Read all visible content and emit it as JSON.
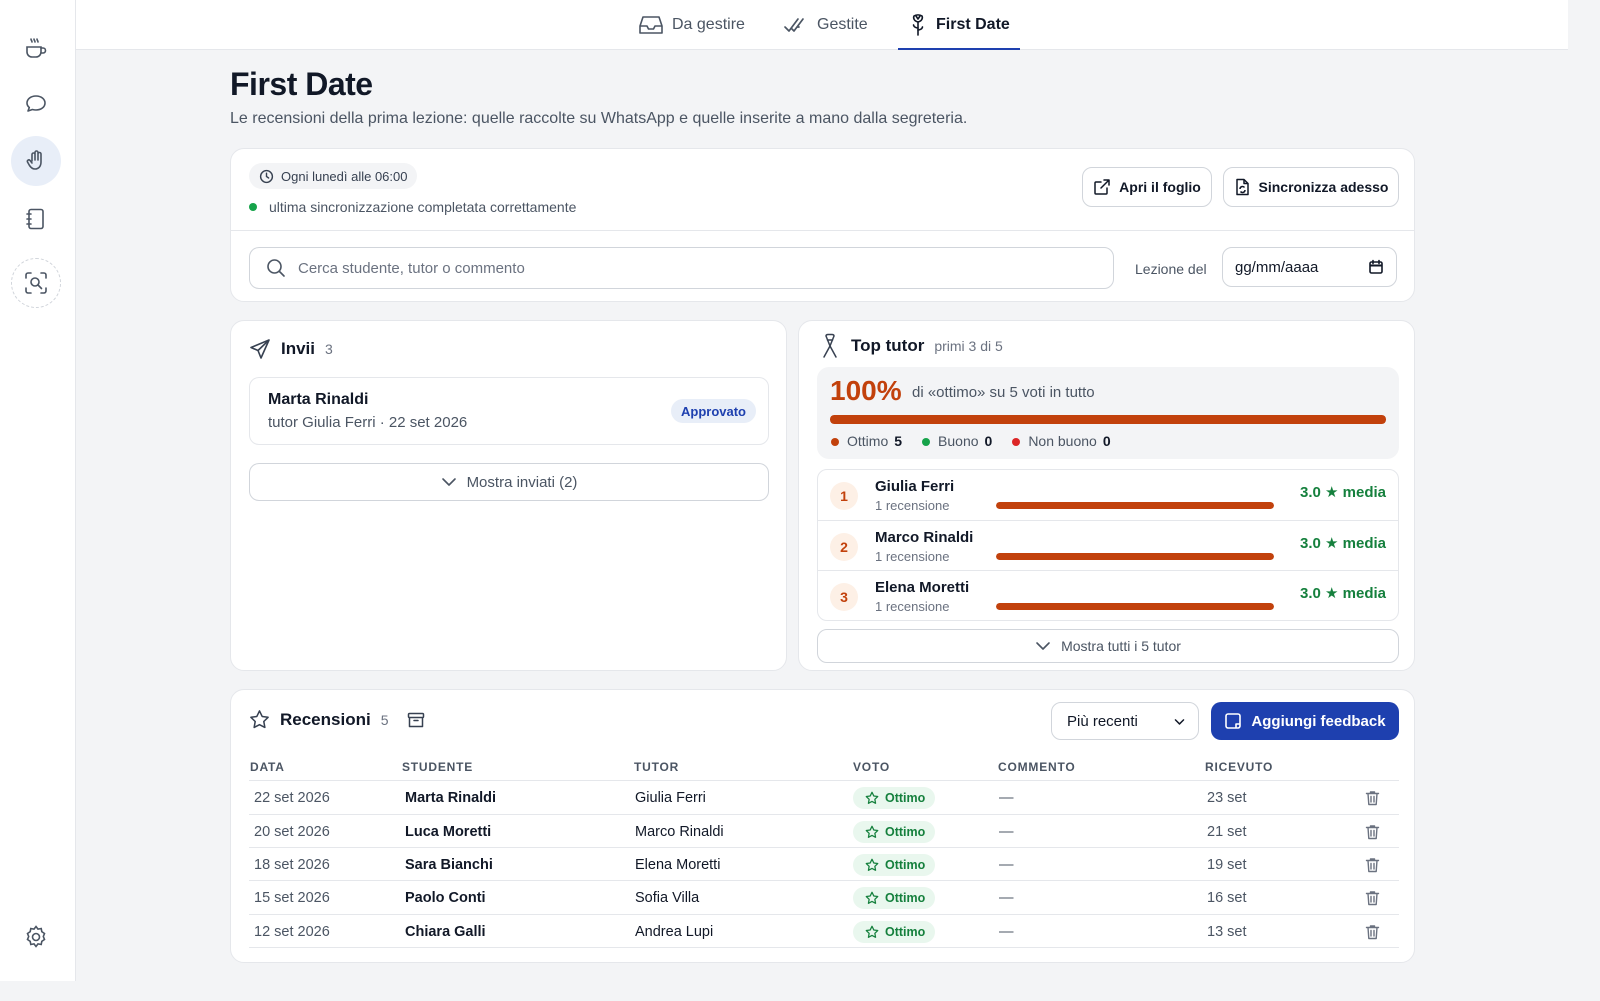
{
  "rail": {
    "items": [
      {
        "name": "coffee-icon"
      },
      {
        "name": "chat-bubble-icon"
      },
      {
        "name": "hand-icon"
      },
      {
        "name": "notebook-icon"
      },
      {
        "name": "scan-search-icon"
      }
    ],
    "settings_icon": "gear-icon"
  },
  "tabs": [
    {
      "label": "Da gestire",
      "icon": "inbox-icon"
    },
    {
      "label": "Gestite",
      "icon": "double-check-icon"
    },
    {
      "label": "First Date",
      "icon": "rose-icon",
      "active": true
    }
  ],
  "page": {
    "title": "First Date",
    "subtitle": "Le recensioni della prima lezione: quelle raccolte su WhatsApp e quelle inserite a mano dalla segreteria."
  },
  "sync": {
    "schedule": "Ogni lunedì alle 06:00",
    "status": "ultima sincronizzazione completata correttamente",
    "status_color": "#16a34a",
    "open_sheet": "Apri il foglio",
    "sync_now": "Sincronizza adesso"
  },
  "filters": {
    "search_placeholder": "Cerca studente, tutor o commento",
    "date_label": "Lezione del",
    "date_placeholder": "gg/mm/aaaa"
  },
  "invii": {
    "title": "Invii",
    "count": "3",
    "item": {
      "student": "Marta Rinaldi",
      "meta": "tutor Giulia Ferri · 22 set 2026",
      "status": "Approvato"
    },
    "show_sent": "Mostra inviati (2)"
  },
  "top_tutor": {
    "title": "Top tutor",
    "subtitle": "primi 3 di 5",
    "percent": "100%",
    "percent_text": "di «ottimo» su 5 voti in tutto",
    "percent_fraction": 1.0,
    "legend": [
      {
        "label": "Ottimo",
        "value": "5",
        "color": "#c2410c"
      },
      {
        "label": "Buono",
        "value": "0",
        "color": "#16a34a"
      },
      {
        "label": "Non buono",
        "value": "0",
        "color": "#dc2626"
      }
    ],
    "tutors": [
      {
        "rank": "1",
        "name": "Giulia Ferri",
        "reviews": "1 recensione",
        "score": "3.0 ★ media",
        "fill": 1.0
      },
      {
        "rank": "2",
        "name": "Marco Rinaldi",
        "reviews": "1 recensione",
        "score": "3.0 ★ media",
        "fill": 1.0
      },
      {
        "rank": "3",
        "name": "Elena Moretti",
        "reviews": "1 recensione",
        "score": "3.0 ★ media",
        "fill": 1.0
      }
    ],
    "show_all": "Mostra tutti i 5 tutor"
  },
  "reviews": {
    "title": "Recensioni",
    "count": "5",
    "sort": "Più recenti",
    "add_feedback": "Aggiungi feedback",
    "columns": [
      "DATA",
      "STUDENTE",
      "TUTOR",
      "VOTO",
      "COMMENTO",
      "RICEVUTO"
    ],
    "rows": [
      {
        "date": "22 set 2026",
        "student": "Marta Rinaldi",
        "tutor": "Giulia Ferri",
        "vote": "Ottimo",
        "comment": "—",
        "received": "23 set"
      },
      {
        "date": "20 set 2026",
        "student": "Luca Moretti",
        "tutor": "Marco Rinaldi",
        "vote": "Ottimo",
        "comment": "—",
        "received": "21 set"
      },
      {
        "date": "18 set 2026",
        "student": "Sara Bianchi",
        "tutor": "Elena Moretti",
        "vote": "Ottimo",
        "comment": "—",
        "received": "19 set"
      },
      {
        "date": "15 set 2026",
        "student": "Paolo Conti",
        "tutor": "Sofia Villa",
        "vote": "Ottimo",
        "comment": "—",
        "received": "16 set"
      },
      {
        "date": "12 set 2026",
        "student": "Chiara Galli",
        "tutor": "Andrea Lupi",
        "vote": "Ottimo",
        "comment": "—",
        "received": "13 set"
      }
    ]
  }
}
